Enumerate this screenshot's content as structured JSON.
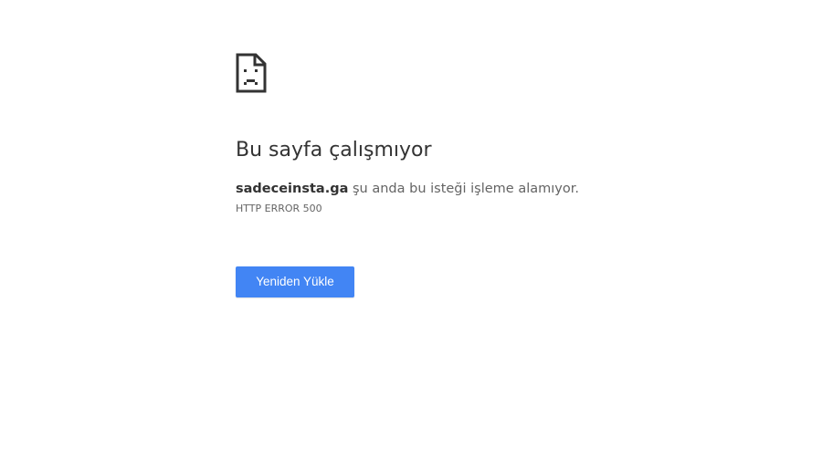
{
  "error": {
    "icon": "sad-document-icon",
    "title": "Bu sayfa çalışmıyor",
    "host": "sadeceinsta.ga",
    "message": " şu anda bu isteği işleme alamıyor.",
    "code": "HTTP ERROR 500"
  },
  "actions": {
    "reload_label": "Yeniden Yükle"
  },
  "colors": {
    "accent": "#4285f4",
    "text_primary": "#333333",
    "text_secondary": "#646464",
    "background": "#ffffff"
  }
}
